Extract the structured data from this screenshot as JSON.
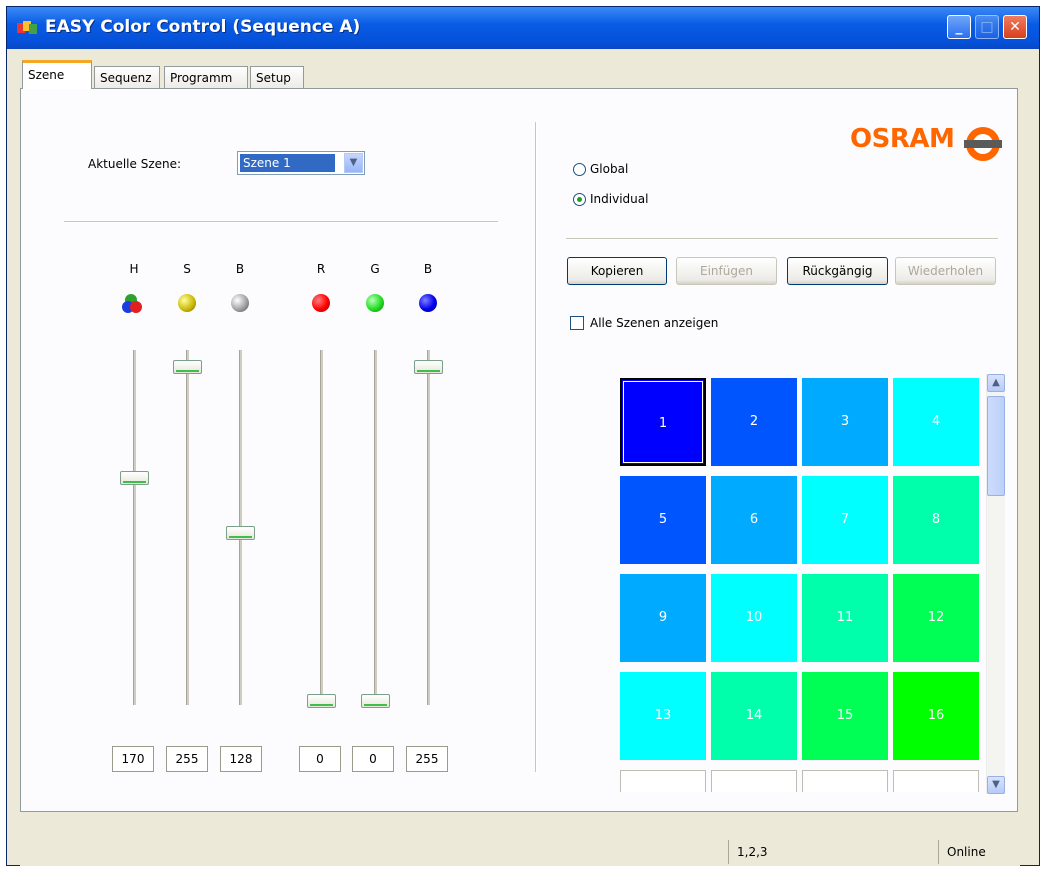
{
  "window": {
    "title": "EASY Color Control (Sequence A)"
  },
  "tabs": [
    {
      "label": "Szene",
      "active": true
    },
    {
      "label": "Sequenz",
      "active": false
    },
    {
      "label": "Programm",
      "active": false
    },
    {
      "label": "Setup",
      "active": false
    }
  ],
  "scene": {
    "label": "Aktuelle Szene:",
    "selected": "Szene 1"
  },
  "channels": [
    {
      "label": "H",
      "icon": "hue-rgb-icon",
      "value": "170",
      "level": 0.667
    },
    {
      "label": "S",
      "icon": "saturation-yellow-icon",
      "value": "255",
      "level": 1.0
    },
    {
      "label": "B",
      "icon": "brightness-gray-icon",
      "value": "128",
      "level": 0.502
    },
    {
      "label": "R",
      "icon": "red-icon",
      "value": "0",
      "level": 0.0
    },
    {
      "label": "G",
      "icon": "green-icon",
      "value": "0",
      "level": 0.0
    },
    {
      "label": "B",
      "icon": "blue-icon",
      "value": "255",
      "level": 1.0
    }
  ],
  "mode": {
    "global_label": "Global",
    "individual_label": "Individual",
    "selected": "Individual"
  },
  "buttons": {
    "copy": "Kopieren",
    "paste": "Einfügen",
    "undo": "Rückgängig",
    "redo": "Wiederholen"
  },
  "show_all": {
    "label": "Alle Szenen anzeigen",
    "checked": false
  },
  "logo": {
    "text": "OSRAM",
    "mark_text": "OSRAM"
  },
  "scenes": [
    {
      "label": "1",
      "color": "#0000ff",
      "selected": true
    },
    {
      "label": "2",
      "color": "#0055ff"
    },
    {
      "label": "3",
      "color": "#00aaff"
    },
    {
      "label": "4",
      "color": "#00ffff"
    },
    {
      "label": "5",
      "color": "#0055ff"
    },
    {
      "label": "6",
      "color": "#00aaff"
    },
    {
      "label": "7",
      "color": "#00ffff"
    },
    {
      "label": "8",
      "color": "#00ffaa"
    },
    {
      "label": "9",
      "color": "#00aaff"
    },
    {
      "label": "10",
      "color": "#00ffff"
    },
    {
      "label": "11",
      "color": "#00ffaa"
    },
    {
      "label": "12",
      "color": "#00ff55"
    },
    {
      "label": "13",
      "color": "#00ffff"
    },
    {
      "label": "14",
      "color": "#00ffaa"
    },
    {
      "label": "15",
      "color": "#00ff55"
    },
    {
      "label": "16",
      "color": "#00ff00"
    }
  ],
  "status": {
    "selection": "1,2,3",
    "connection": "Online"
  }
}
